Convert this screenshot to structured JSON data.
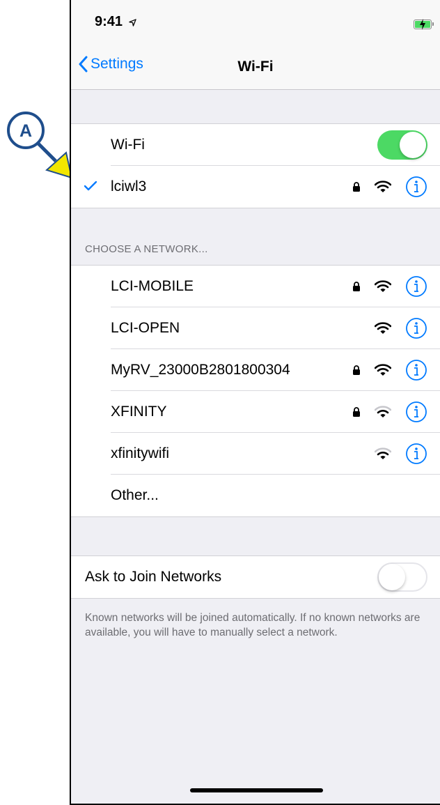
{
  "status_bar": {
    "time": "9:41"
  },
  "nav": {
    "back_label": "Settings",
    "title": "Wi-Fi"
  },
  "wifi_toggle": {
    "label": "Wi-Fi",
    "state": "on"
  },
  "connected_network": {
    "name": "lciwl3",
    "secured": true
  },
  "section_header": "CHOOSE A NETWORK...",
  "networks": [
    {
      "name": "LCI-MOBILE",
      "secured": true,
      "signal": "full"
    },
    {
      "name": "LCI-OPEN",
      "secured": false,
      "signal": "full"
    },
    {
      "name": "MyRV_23000B2801800304",
      "secured": true,
      "signal": "full"
    },
    {
      "name": "XFINITY",
      "secured": true,
      "signal": "weak"
    },
    {
      "name": "xfinitywifi",
      "secured": false,
      "signal": "weak"
    }
  ],
  "other_label": "Other...",
  "ask_to_join": {
    "label": "Ask to Join Networks",
    "state": "off"
  },
  "footer_text": "Known networks will be joined automatically. If no known networks are available, you will have to manually select a network.",
  "annotation": {
    "label": "A"
  },
  "colors": {
    "accent": "#007aff",
    "toggle_on": "#4cd964",
    "annotation_arrow": "#f2e600",
    "annotation_stroke": "#1f4e8c"
  }
}
